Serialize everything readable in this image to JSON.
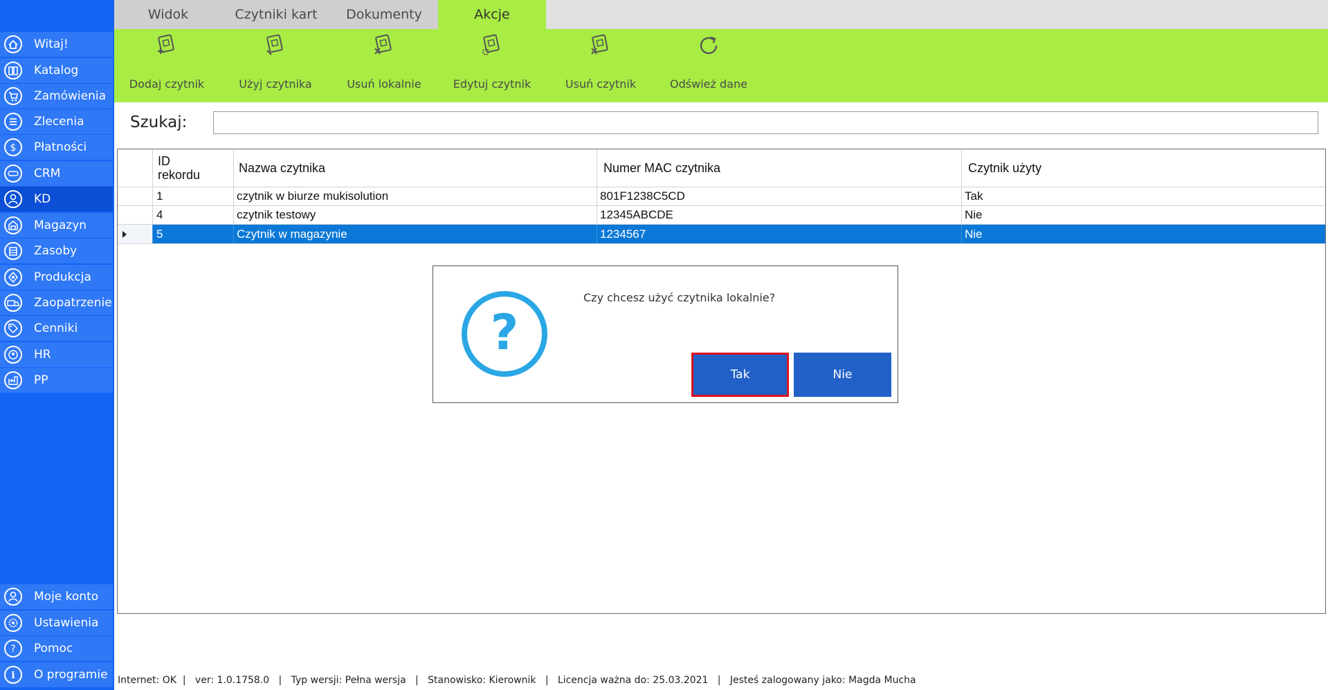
{
  "sidebar": {
    "items": [
      {
        "label": "Witaj!",
        "icon": "home-icon"
      },
      {
        "label": "Katalog",
        "icon": "book-icon"
      },
      {
        "label": "Zamówienia",
        "icon": "cart-icon"
      },
      {
        "label": "Zlecenia",
        "icon": "list-icon"
      },
      {
        "label": "Płatności",
        "icon": "dollar-icon"
      },
      {
        "label": "CRM",
        "icon": "crm-icon"
      },
      {
        "label": "KD",
        "icon": "person-icon"
      },
      {
        "label": "Magazyn",
        "icon": "warehouse-icon"
      },
      {
        "label": "Zasoby",
        "icon": "resources-icon"
      },
      {
        "label": "Produkcja",
        "icon": "production-icon"
      },
      {
        "label": "Zaopatrzenie",
        "icon": "truck-icon"
      },
      {
        "label": "Cenniki",
        "icon": "price-tag-icon"
      },
      {
        "label": "HR",
        "icon": "hr-icon"
      },
      {
        "label": "PP",
        "icon": "pp-icon"
      }
    ],
    "bottom_items": [
      {
        "label": "Moje konto",
        "icon": "account-icon"
      },
      {
        "label": "Ustawienia",
        "icon": "settings-icon"
      },
      {
        "label": "Pomoc",
        "icon": "help-icon"
      },
      {
        "label": "O programie",
        "icon": "info-icon"
      }
    ],
    "active": "KD"
  },
  "tabs": [
    "Widok",
    "Czytniki kart",
    "Dokumenty",
    "Akcje"
  ],
  "active_tab": "Akcje",
  "ribbon": {
    "buttons": [
      {
        "label": "Dodaj czytnik",
        "icon": "add-reader-icon"
      },
      {
        "label": "Użyj czytnika",
        "icon": "use-reader-icon"
      },
      {
        "label": "Usuń lokalnie",
        "icon": "remove-local-icon"
      },
      {
        "label": "Edytuj czytnik",
        "icon": "edit-reader-icon"
      },
      {
        "label": "Usuń czytnik",
        "icon": "delete-reader-icon"
      },
      {
        "label": "Odśwież dane",
        "icon": "refresh-icon"
      }
    ]
  },
  "search": {
    "label": "Szukaj:",
    "value": ""
  },
  "table": {
    "headers": [
      "ID\nrekordu",
      "Nazwa czytnika",
      "Numer MAC czytnika",
      "Czytnik użyty"
    ],
    "rows": [
      {
        "id": "1",
        "name": "czytnik w biurze mukisolution",
        "mac": "801F1238C5CD",
        "used": "Tak"
      },
      {
        "id": "4",
        "name": "czytnik testowy",
        "mac": "12345ABCDE",
        "used": "Nie"
      },
      {
        "id": "5",
        "name": "Czytnik w magazynie",
        "mac": "1234567",
        "used": "Nie"
      }
    ],
    "selected_row_index": 2
  },
  "dialog": {
    "message": "Czy chcesz użyć czytnika lokalnie?",
    "yes_label": "Tak",
    "no_label": "Nie",
    "icon": "question-icon"
  },
  "statusbar": {
    "text": "Internet: OK  |   ver: 1.0.1758.0   |   Typ wersji: Pełna wersja   |   Stanowisko: Kierownik   |   Licencja ważna do: 25.03.2021   |   Jesteś zalogowany jako: Magda Mucha"
  },
  "colors": {
    "sidebar": "#1464f4",
    "sidebar_item": "#2f78f6",
    "ribbon": "#a8ec44",
    "selection": "#0b78d7",
    "dialog_button": "#2161c7",
    "focus_border": "#d9141e"
  }
}
